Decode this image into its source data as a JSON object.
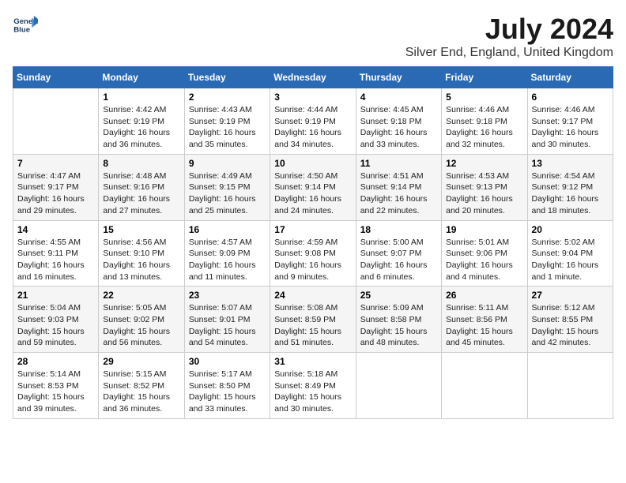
{
  "header": {
    "logo_line1": "General",
    "logo_line2": "Blue",
    "title": "July 2024",
    "subtitle": "Silver End, England, United Kingdom"
  },
  "columns": [
    "Sunday",
    "Monday",
    "Tuesday",
    "Wednesday",
    "Thursday",
    "Friday",
    "Saturday"
  ],
  "weeks": [
    [
      {
        "day": "",
        "info": ""
      },
      {
        "day": "1",
        "info": "Sunrise: 4:42 AM\nSunset: 9:19 PM\nDaylight: 16 hours\nand 36 minutes."
      },
      {
        "day": "2",
        "info": "Sunrise: 4:43 AM\nSunset: 9:19 PM\nDaylight: 16 hours\nand 35 minutes."
      },
      {
        "day": "3",
        "info": "Sunrise: 4:44 AM\nSunset: 9:19 PM\nDaylight: 16 hours\nand 34 minutes."
      },
      {
        "day": "4",
        "info": "Sunrise: 4:45 AM\nSunset: 9:18 PM\nDaylight: 16 hours\nand 33 minutes."
      },
      {
        "day": "5",
        "info": "Sunrise: 4:46 AM\nSunset: 9:18 PM\nDaylight: 16 hours\nand 32 minutes."
      },
      {
        "day": "6",
        "info": "Sunrise: 4:46 AM\nSunset: 9:17 PM\nDaylight: 16 hours\nand 30 minutes."
      }
    ],
    [
      {
        "day": "7",
        "info": "Sunrise: 4:47 AM\nSunset: 9:17 PM\nDaylight: 16 hours\nand 29 minutes."
      },
      {
        "day": "8",
        "info": "Sunrise: 4:48 AM\nSunset: 9:16 PM\nDaylight: 16 hours\nand 27 minutes."
      },
      {
        "day": "9",
        "info": "Sunrise: 4:49 AM\nSunset: 9:15 PM\nDaylight: 16 hours\nand 25 minutes."
      },
      {
        "day": "10",
        "info": "Sunrise: 4:50 AM\nSunset: 9:14 PM\nDaylight: 16 hours\nand 24 minutes."
      },
      {
        "day": "11",
        "info": "Sunrise: 4:51 AM\nSunset: 9:14 PM\nDaylight: 16 hours\nand 22 minutes."
      },
      {
        "day": "12",
        "info": "Sunrise: 4:53 AM\nSunset: 9:13 PM\nDaylight: 16 hours\nand 20 minutes."
      },
      {
        "day": "13",
        "info": "Sunrise: 4:54 AM\nSunset: 9:12 PM\nDaylight: 16 hours\nand 18 minutes."
      }
    ],
    [
      {
        "day": "14",
        "info": "Sunrise: 4:55 AM\nSunset: 9:11 PM\nDaylight: 16 hours\nand 16 minutes."
      },
      {
        "day": "15",
        "info": "Sunrise: 4:56 AM\nSunset: 9:10 PM\nDaylight: 16 hours\nand 13 minutes."
      },
      {
        "day": "16",
        "info": "Sunrise: 4:57 AM\nSunset: 9:09 PM\nDaylight: 16 hours\nand 11 minutes."
      },
      {
        "day": "17",
        "info": "Sunrise: 4:59 AM\nSunset: 9:08 PM\nDaylight: 16 hours\nand 9 minutes."
      },
      {
        "day": "18",
        "info": "Sunrise: 5:00 AM\nSunset: 9:07 PM\nDaylight: 16 hours\nand 6 minutes."
      },
      {
        "day": "19",
        "info": "Sunrise: 5:01 AM\nSunset: 9:06 PM\nDaylight: 16 hours\nand 4 minutes."
      },
      {
        "day": "20",
        "info": "Sunrise: 5:02 AM\nSunset: 9:04 PM\nDaylight: 16 hours\nand 1 minute."
      }
    ],
    [
      {
        "day": "21",
        "info": "Sunrise: 5:04 AM\nSunset: 9:03 PM\nDaylight: 15 hours\nand 59 minutes."
      },
      {
        "day": "22",
        "info": "Sunrise: 5:05 AM\nSunset: 9:02 PM\nDaylight: 15 hours\nand 56 minutes."
      },
      {
        "day": "23",
        "info": "Sunrise: 5:07 AM\nSunset: 9:01 PM\nDaylight: 15 hours\nand 54 minutes."
      },
      {
        "day": "24",
        "info": "Sunrise: 5:08 AM\nSunset: 8:59 PM\nDaylight: 15 hours\nand 51 minutes."
      },
      {
        "day": "25",
        "info": "Sunrise: 5:09 AM\nSunset: 8:58 PM\nDaylight: 15 hours\nand 48 minutes."
      },
      {
        "day": "26",
        "info": "Sunrise: 5:11 AM\nSunset: 8:56 PM\nDaylight: 15 hours\nand 45 minutes."
      },
      {
        "day": "27",
        "info": "Sunrise: 5:12 AM\nSunset: 8:55 PM\nDaylight: 15 hours\nand 42 minutes."
      }
    ],
    [
      {
        "day": "28",
        "info": "Sunrise: 5:14 AM\nSunset: 8:53 PM\nDaylight: 15 hours\nand 39 minutes."
      },
      {
        "day": "29",
        "info": "Sunrise: 5:15 AM\nSunset: 8:52 PM\nDaylight: 15 hours\nand 36 minutes."
      },
      {
        "day": "30",
        "info": "Sunrise: 5:17 AM\nSunset: 8:50 PM\nDaylight: 15 hours\nand 33 minutes."
      },
      {
        "day": "31",
        "info": "Sunrise: 5:18 AM\nSunset: 8:49 PM\nDaylight: 15 hours\nand 30 minutes."
      },
      {
        "day": "",
        "info": ""
      },
      {
        "day": "",
        "info": ""
      },
      {
        "day": "",
        "info": ""
      }
    ]
  ]
}
